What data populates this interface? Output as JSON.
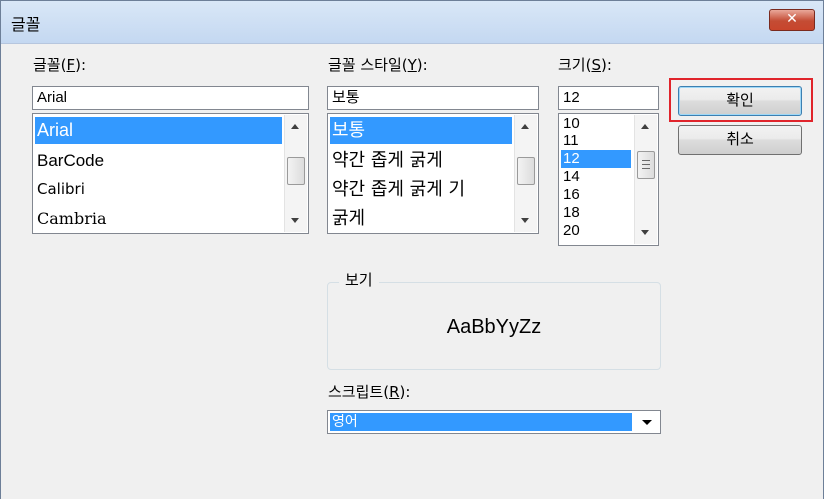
{
  "dialog": {
    "title": "글꼴",
    "close_symbol": "✕"
  },
  "font": {
    "label_prefix": "글꼴(",
    "label_key": "F",
    "label_suffix": "):",
    "value": "Arial",
    "items": [
      "Arial",
      "BarCode",
      "Calibri",
      "Cambria"
    ],
    "selected": "Arial"
  },
  "style": {
    "label_prefix": "글꼴 스타일(",
    "label_key": "Y",
    "label_suffix": "):",
    "value": "보통",
    "items": [
      "보통",
      "약간 좁게 굵게",
      "약간 좁게 굵게 기",
      "굵게"
    ],
    "selected": "보통"
  },
  "size": {
    "label_prefix": "크기(",
    "label_key": "S",
    "label_suffix": "):",
    "value": "12",
    "items": [
      "10",
      "11",
      "12",
      "14",
      "16",
      "18",
      "20"
    ],
    "selected": "12"
  },
  "buttons": {
    "ok": "확인",
    "cancel": "취소"
  },
  "preview": {
    "label": "보기",
    "sample": "AaBbYyZz"
  },
  "script": {
    "label_prefix": "스크립트(",
    "label_key": "R",
    "label_suffix": "):",
    "value": "영어"
  }
}
